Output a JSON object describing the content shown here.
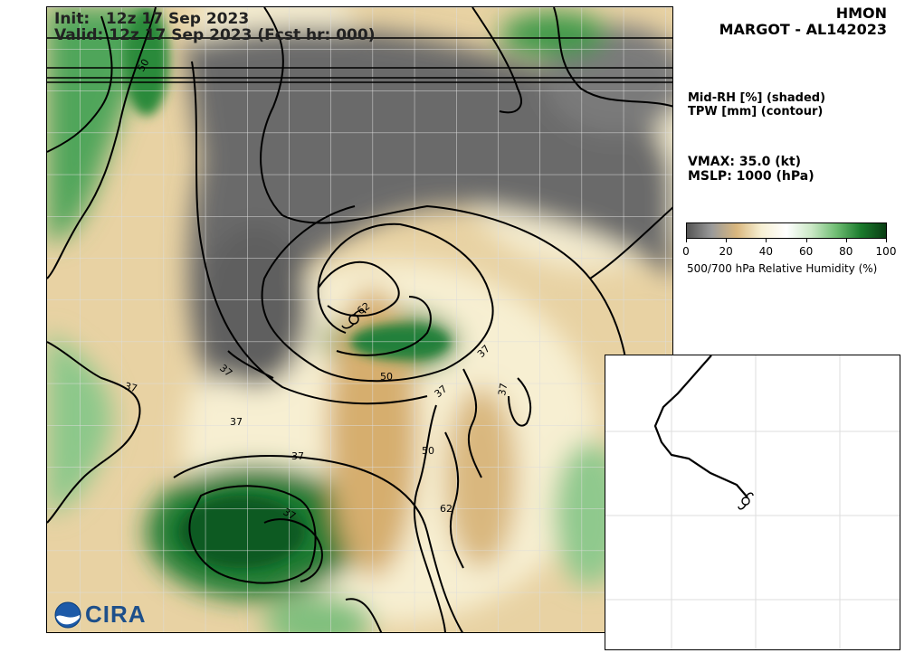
{
  "header": {
    "init_line": "Init:   12z 17 Sep 2023",
    "valid_line": "Valid: 12z 17 Sep 2023 (Fcst hr: 000)"
  },
  "title": {
    "model": "HMON",
    "storm": "MARGOT - AL142023"
  },
  "legend": {
    "line1": "Mid-RH [%] (shaded)",
    "line2": "TPW [mm] (contour)"
  },
  "storm_info": {
    "vmax": "VMAX:  35.0 (kt)",
    "mslp": "MSLP: 1000 (hPa)"
  },
  "colorbar": {
    "ticks": [
      "0",
      "20",
      "40",
      "60",
      "80",
      "100"
    ],
    "label": "500/700 hPa Relative Humidity (%)",
    "colors": [
      "#555555",
      "#9a9a9a",
      "#d9b77e",
      "#f7f0d4",
      "#ffffff",
      "#cbe8c6",
      "#6fbd73",
      "#1a7a2c",
      "#0a3d14"
    ]
  },
  "contour_labels": [
    "50",
    "62",
    "37",
    "37",
    "50",
    "37",
    "37",
    "37",
    "37",
    "50",
    "37",
    "62",
    "37"
  ],
  "logo": {
    "text": "CIRA",
    "icon": "noaa-logo-icon"
  },
  "colors": {
    "dry": "#666666",
    "moist": "#2a8a3a",
    "neutral": "#f7f0d4",
    "tan": "#d9b77e"
  }
}
